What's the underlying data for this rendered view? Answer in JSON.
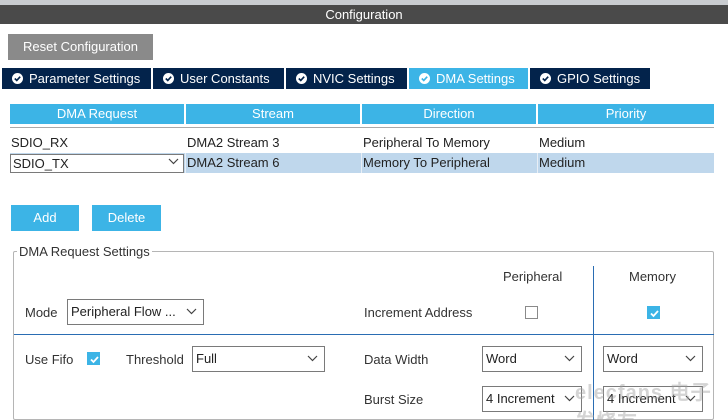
{
  "window": {
    "title": "Configuration"
  },
  "toolbar": {
    "reset_label": "Reset Configuration"
  },
  "tabs": [
    {
      "label": "Parameter Settings",
      "active": false
    },
    {
      "label": "User Constants",
      "active": false
    },
    {
      "label": "NVIC Settings",
      "active": false
    },
    {
      "label": "DMA Settings",
      "active": true
    },
    {
      "label": "GPIO Settings",
      "active": false
    }
  ],
  "dma_table": {
    "columns": [
      "DMA Request",
      "Stream",
      "Direction",
      "Priority"
    ],
    "rows": [
      {
        "request": "SDIO_RX",
        "stream": "DMA2 Stream 3",
        "direction": "Peripheral To Memory",
        "priority": "Medium"
      },
      {
        "request": "SDIO_TX",
        "stream": "DMA2 Stream 6",
        "direction": "Memory To Peripheral",
        "priority": "Medium"
      }
    ]
  },
  "actions": {
    "add_label": "Add",
    "delete_label": "Delete"
  },
  "settings": {
    "group_title": "DMA Request Settings",
    "peripheral_header": "Peripheral",
    "memory_header": "Memory",
    "mode_label": "Mode",
    "mode_value": "Peripheral Flow ...",
    "increment_label": "Increment Address",
    "increment_peripheral": false,
    "increment_memory": true,
    "use_fifo_label": "Use Fifo",
    "use_fifo": true,
    "threshold_label": "Threshold",
    "threshold_value": "Full",
    "data_width_label": "Data Width",
    "data_width_peripheral": "Word",
    "data_width_memory": "Word",
    "burst_size_label": "Burst Size",
    "burst_size_peripheral": "4 Increment",
    "burst_size_memory": "4 Increment"
  },
  "watermark": {
    "text": "elecfans 电子发烧友"
  },
  "colors": {
    "accent": "#3cb4e6",
    "tab_dark": "#03234b",
    "selected_row": "#bfd7ec"
  }
}
